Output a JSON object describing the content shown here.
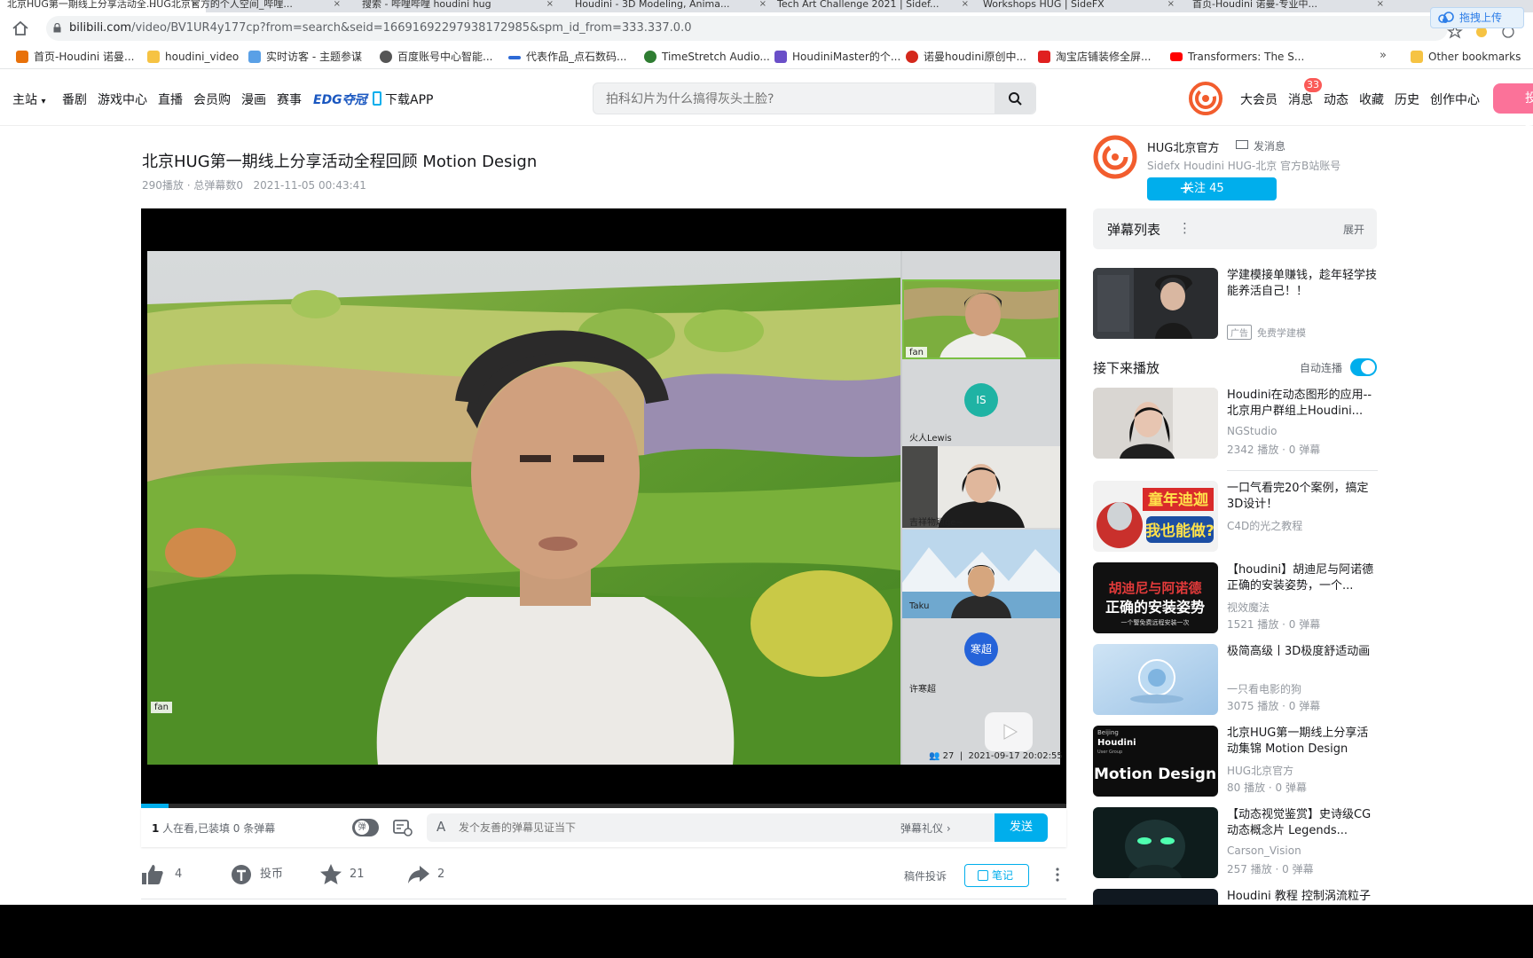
{
  "browser": {
    "tabs": [
      {
        "label": "北京HUG第一期线上分享活动全..."
      },
      {
        "label": "HUG北京官方的个人空间_哔哩..."
      },
      {
        "label": "搜索 - 哔哩哔哩 houdini hug"
      },
      {
        "label": "Houdini - 3D Modeling, Anima..."
      },
      {
        "label": "Tech Art Challenge 2021 | Sidef..."
      },
      {
        "label": "Workshops HUG | SideFX"
      },
      {
        "label": "首页-Houdini 诺曼-专业中..."
      }
    ],
    "upload_pill": "拖拽上传",
    "url_host": "bilibili.com",
    "url_path": "/video/BV1UR4y177cp?from=search&seid=16691692297938172985&spm_id_from=333.337.0.0",
    "bookmarks": [
      {
        "label": "首页-Houdini 诺曼...",
        "color": "#e8710a"
      },
      {
        "label": "houdini_video",
        "color": "#f6c343"
      },
      {
        "label": "实时访客 - 主题参谋",
        "color": "#5aa0e6"
      },
      {
        "label": "百度账号中心智能...",
        "color": "#555555"
      },
      {
        "label": "代表作品_点石数码...",
        "color": "#2d6ad6"
      },
      {
        "label": "TimeStretch Audio...",
        "color": "#2f7d32"
      },
      {
        "label": "HoudiniMaster的个...",
        "color": "#6a4fc8"
      },
      {
        "label": "诺曼houdini原创中...",
        "color": "#d4281c"
      },
      {
        "label": "淘宝店铺装修全屏...",
        "color": "#e02020"
      },
      {
        "label": "Transformers: The S...",
        "color": "#ff0000"
      }
    ],
    "bookmarks_more": "»",
    "other_bookmarks": "Other bookmarks"
  },
  "header": {
    "nav": [
      "主站",
      "番剧",
      "游戏中心",
      "直播",
      "会员购",
      "漫画",
      "赛事"
    ],
    "edg": "EDG夺冠",
    "download": "下载APP",
    "search_placeholder": "拍科幻片为什么搞得灰头土脸?",
    "right_nav": [
      "大会员",
      "消息",
      "动态",
      "收藏",
      "历史",
      "创作中心"
    ],
    "message_badge": "33",
    "post_button": "投稿"
  },
  "video": {
    "title": "北京HUG第一期线上分享活动全程回顾 Motion Design",
    "views": "290播放",
    "danmaku_count": "总弹幕数0",
    "date": "2021-11-05 00:43:41",
    "progress": 0.03,
    "player": {
      "main_name": "fan",
      "participants": [
        {
          "name": "fan",
          "kind": "video"
        },
        {
          "name": "火人Lewis",
          "kind": "avatar",
          "initials": "IS",
          "color": "#1fb3a4"
        },
        {
          "name": "吉祥物颖ge~",
          "kind": "video"
        },
        {
          "name": "Taku",
          "kind": "video"
        },
        {
          "name": "许寒超",
          "kind": "avatar",
          "initials": "寒超",
          "color": "#2563d9"
        }
      ],
      "count": "27",
      "timestamp": "2021-09-17 20:02:55"
    }
  },
  "danmaku_bar": {
    "viewers_prefix": "1",
    "viewers_text": " 人在看,已装填 0 条弹幕",
    "toggle_label": "弹",
    "placeholder": "发个友善的弹幕见证当下",
    "etiquette": "弹幕礼仪 ›",
    "send": "发送"
  },
  "actions": {
    "like": "4",
    "coin": "投币",
    "favorite": "21",
    "share": "2",
    "report": "稿件投诉",
    "note": "笔记"
  },
  "uploader": {
    "name": "HUG北京官方",
    "message": "发消息",
    "desc": "Sidefx Houdini HUG-北京 官方B站账号",
    "follow": "关注 45"
  },
  "danmaku_list": {
    "title": "弹幕列表",
    "expand": "展开"
  },
  "ad": {
    "title": "学建模接单赚钱，趁年轻学技能养活自己！！",
    "tag": "广告",
    "source": "免费学建模"
  },
  "next_up": {
    "title": "接下来播放",
    "autoplay": "自动连播",
    "autoplay_on": true
  },
  "recommendations": [
    {
      "title": "Houdini在动态图形的应用--北京用户群组上Houdini...",
      "up": "NGStudio",
      "stats": "2342 播放 · 0 弹幕"
    },
    {
      "title": "一口气看完20个案例，搞定3D设计！",
      "up": "C4D的光之教程",
      "stats": ""
    },
    {
      "title": "【houdini】胡迪尼与阿诺德正确的安装姿势，一个...",
      "up": "视效魔法",
      "stats": "1521 播放 · 0 弹幕"
    },
    {
      "title": "极简高级丨3D极度舒适动画",
      "up": "一只看电影的狗",
      "stats": "3075 播放 · 0 弹幕"
    },
    {
      "title": "北京HUG第一期线上分享活动集锦 Motion Design",
      "up": "HUG北京官方",
      "stats": "80 播放 · 0 弹幕"
    },
    {
      "title": "【动态视觉鉴赏】史诗级CG动态概念片 Legends...",
      "up": "Carson_Vision",
      "stats": "257 播放 · 0 弹幕"
    },
    {
      "title": "Houdini 教程 控制涡流粒子",
      "up": "",
      "stats": ""
    }
  ],
  "thumb_text": {
    "rec2_line1": "童年迪迦",
    "rec2_line2": "我也能做?",
    "rec3_line1": "胡迪尼与阿诺德",
    "rec3_line2": "正确的安装姿势",
    "rec3_line3": "一个警免费远程安装一次",
    "rec5_small1": "Beijing",
    "rec5_brand": "Houdini",
    "rec5_small2": "User Group",
    "rec5_big": "Motion Design"
  }
}
